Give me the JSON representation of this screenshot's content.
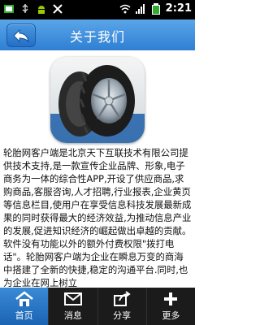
{
  "statusbar": {
    "time": "2:21"
  },
  "header": {
    "title": "关于我们"
  },
  "content": {
    "description": "轮胎网客户端是北京天下互联技术有限公司提供技术支持,是一款宣传企业品牌、形象,电子商务为一体的综合性APP,开设了供应商品,求购商品,客服咨询,人才招聘,行业报表,企业黄页等信息栏目,使用户在享受信息科技发展最新成果的同时获得最大的经济效益,为推动信息产业的发展,促进知识经济的崛起做出卓越的贡献。软件没有功能以外的额外付费权限\"拨打电话\"。轮胎网客户端为企业在瞬息万变的商海中搭建了全新的快捷,稳定的沟通平台.同时,也为企业在网上树立"
  },
  "tabs": [
    {
      "label": "首页",
      "icon": "home-icon",
      "active": true
    },
    {
      "label": "消息",
      "icon": "mail-icon",
      "active": false
    },
    {
      "label": "分享",
      "icon": "share-icon",
      "active": false
    },
    {
      "label": "更多",
      "icon": "plus-icon",
      "active": false
    }
  ],
  "colors": {
    "header": "#2f7fd4",
    "tabbar": "#1b1b1b",
    "active_tab": "#1b63b3"
  }
}
